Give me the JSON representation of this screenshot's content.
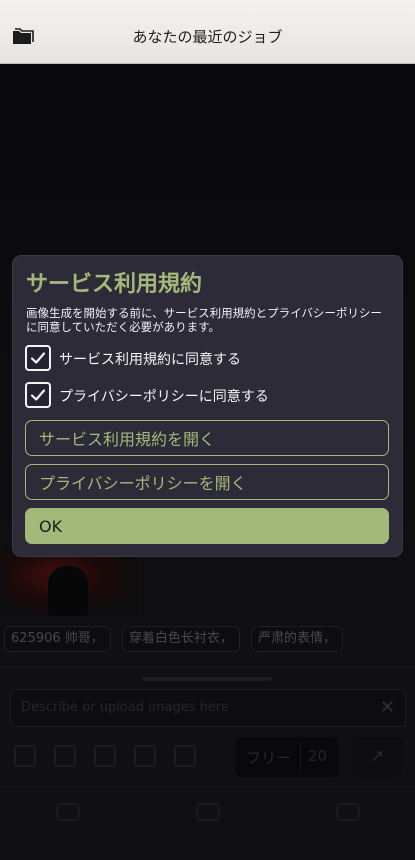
{
  "header": {
    "title": "あなたの最近のジョブ",
    "left_icon": "folder-icon"
  },
  "background": {
    "prompt_tags": [
      "625906 帅哥，",
      "穿着白色长衬衣，",
      "严肃的表情，"
    ],
    "input_placeholder": "Describe or upload images here",
    "plan_label": "フリー",
    "plan_count": "20"
  },
  "dialog": {
    "title": "サービス利用規約",
    "description": "画像生成を開始する前に、サービス利用規約とプライバシーポリシーに同意していただく必要があります。",
    "checks": [
      {
        "label": "サービス利用規約に同意する",
        "checked": true
      },
      {
        "label": "プライバシーポリシーに同意する",
        "checked": true
      }
    ],
    "open_terms_label": "サービス利用規約を開く",
    "open_privacy_label": "プライバシーポリシーを開く",
    "ok_label": "OK"
  },
  "colors": {
    "accent": "#a2b97a",
    "dialog_bg": "#2d2b38",
    "header_bg": "#f0efec"
  }
}
